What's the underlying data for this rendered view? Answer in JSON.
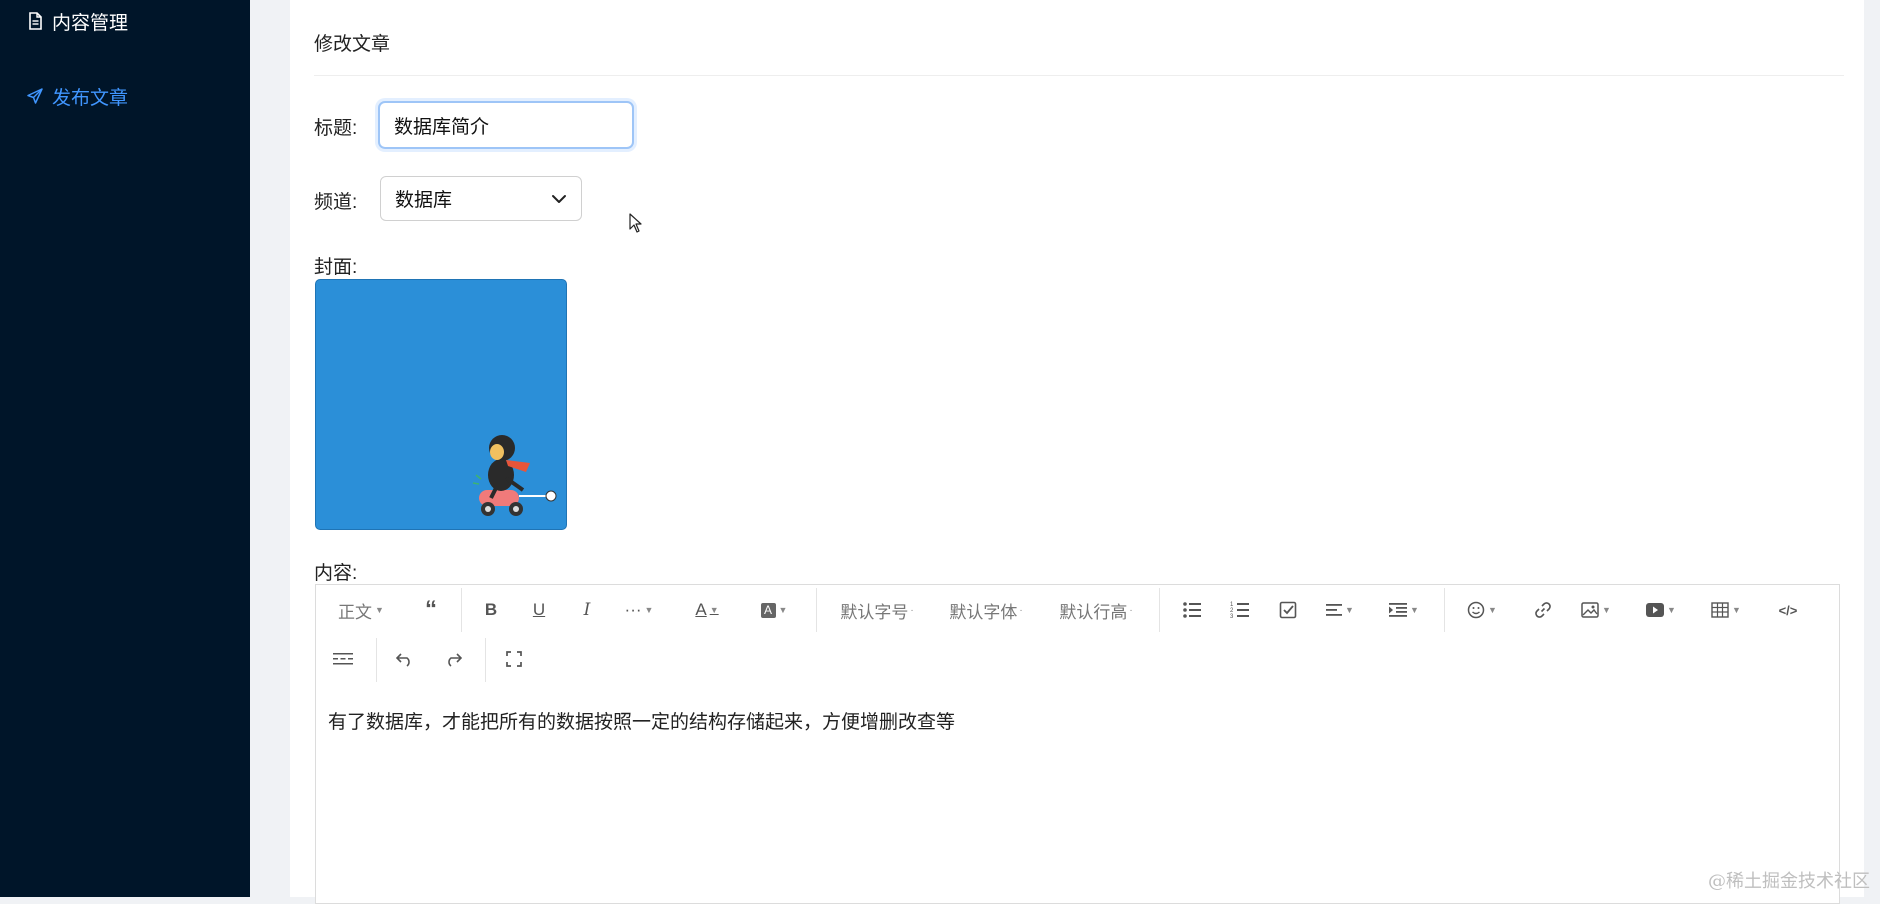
{
  "sidebar": {
    "items": [
      {
        "label": "内容管理",
        "icon": "file-icon"
      },
      {
        "label": "发布文章",
        "icon": "send-icon"
      }
    ],
    "active_color": "#4096ff",
    "background": "#001529"
  },
  "card": {
    "title": "修改文章"
  },
  "form": {
    "title_label": "标题:",
    "title_value": "数据库简介",
    "channel_label": "频道:",
    "channel_value": "数据库",
    "cover_label": "封面:",
    "content_label": "内容:"
  },
  "editor": {
    "toolbar": {
      "paragraph": "正文",
      "font_size": "默认字号",
      "font_family": "默认字体",
      "line_height": "默认行高"
    },
    "content": "有了数据库，才能把所有的数据按照一定的结构存储起来，方便增删改查等"
  },
  "watermark": "@稀土掘金技术社区"
}
